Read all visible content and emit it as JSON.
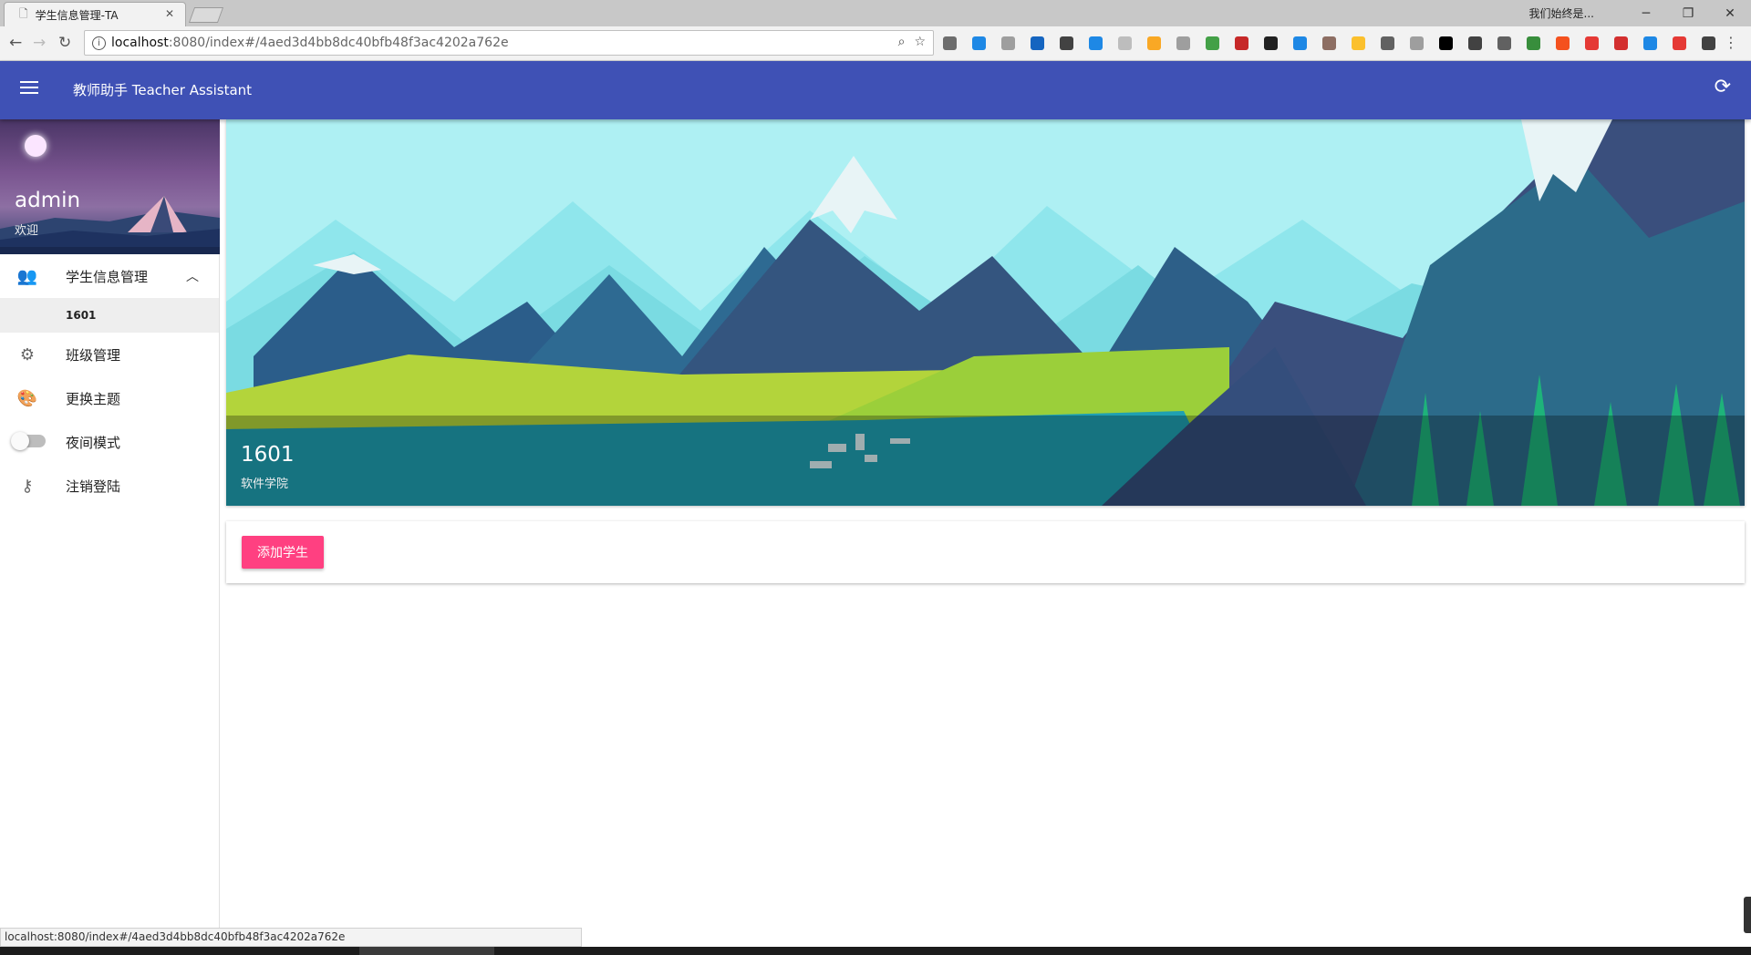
{
  "browser": {
    "tab_title": "学生信息管理-TA",
    "tab_close": "✕",
    "profile_name": "我们始终是...",
    "window_controls": [
      "─",
      "❐",
      "✕"
    ],
    "url_host": "localhost",
    "url_rest": ":8080/index#/4aed3d4bb8dc40bfb48f3ac4202a762e",
    "back_icon": "←",
    "forward_icon": "→",
    "reload_icon": "↻",
    "zoom_icon": "⌕",
    "star_icon": "☆",
    "menu_icon": "⋮",
    "extensions": [
      {
        "name": "off-ext",
        "color": "#6d6d6d"
      },
      {
        "name": "ext-2",
        "color": "#1e88e5"
      },
      {
        "name": "ext-3",
        "color": "#9e9e9e"
      },
      {
        "name": "calendar-ext",
        "color": "#1565c0"
      },
      {
        "name": "evernote-ext",
        "color": "#424242"
      },
      {
        "name": "ext-6",
        "color": "#1e88e5"
      },
      {
        "name": "ext-7",
        "color": "#bdbdbd"
      },
      {
        "name": "ext-8",
        "color": "#f9a825"
      },
      {
        "name": "ext-9",
        "color": "#9e9e9e"
      },
      {
        "name": "chrome-ext",
        "color": "#43a047"
      },
      {
        "name": "pdf-ext",
        "color": "#c62828"
      },
      {
        "name": "ext-12",
        "color": "#212121"
      },
      {
        "name": "translate-ext",
        "color": "#1e88e5"
      },
      {
        "name": "ext-14",
        "color": "#8d6e63"
      },
      {
        "name": "ext-15",
        "color": "#fbc02d"
      },
      {
        "name": "angular-ext",
        "color": "#616161"
      },
      {
        "name": "ext-17",
        "color": "#9e9e9e"
      },
      {
        "name": "jb-ext",
        "color": "#000000"
      },
      {
        "name": "ext-19",
        "color": "#424242"
      },
      {
        "name": "vue-ext",
        "color": "#616161"
      },
      {
        "name": "ext-21",
        "color": "#388e3c"
      },
      {
        "name": "ext-22",
        "color": "#f4511e"
      },
      {
        "name": "ext-23",
        "color": "#e53935"
      },
      {
        "name": "fe-ext",
        "color": "#d32f2f"
      },
      {
        "name": "ext-25",
        "color": "#1e88e5"
      },
      {
        "name": "map-pin-ext",
        "color": "#e53935"
      },
      {
        "name": "ext-27",
        "color": "#424242"
      }
    ],
    "status_url": "localhost:8080/index#/4aed3d4bb8dc40bfb48f3ac4202a762e"
  },
  "appbar": {
    "title": "教师助手 Teacher Assistant",
    "refresh_icon": "⟳",
    "color": "#3f51b5"
  },
  "drawer": {
    "user_name": "admin",
    "greeting": "欢迎",
    "items": [
      {
        "label": "学生信息管理",
        "icon": "people-icon",
        "glyph": "👥",
        "expanded": true,
        "chevron": "︿"
      },
      {
        "label": "班级管理",
        "icon": "gear-icon",
        "glyph": "⚙"
      },
      {
        "label": "更换主题",
        "icon": "palette-icon",
        "glyph": "🎨"
      },
      {
        "label": "夜间模式",
        "icon": "toggle-switch",
        "toggle": false
      },
      {
        "label": "注销登陆",
        "icon": "key-icon",
        "glyph": "⚷"
      }
    ],
    "sub_items": [
      "1601"
    ]
  },
  "main": {
    "class_name": "1601",
    "college": "软件学院",
    "add_button": "添加学生",
    "accent": "#ff4081"
  }
}
